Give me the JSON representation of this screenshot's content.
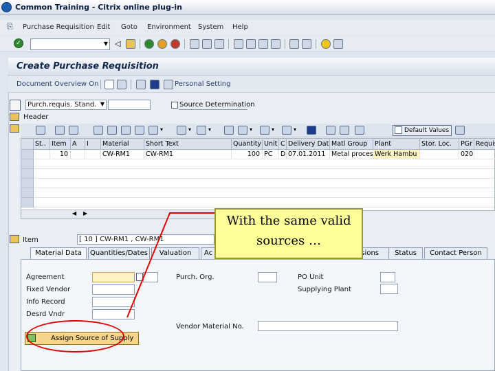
{
  "window": {
    "title": "Common Training - Citrix online plug-in"
  },
  "menu": {
    "items": [
      {
        "label": "Purchase Requisition",
        "underline": "P"
      },
      {
        "label": "Edit",
        "underline": "E"
      },
      {
        "label": "Goto",
        "underline": "G"
      },
      {
        "label": "Environment",
        "underline": "v"
      },
      {
        "label": "System",
        "underline": "y"
      },
      {
        "label": "Help",
        "underline": "H"
      }
    ]
  },
  "screen": {
    "title": "Create Purchase Requisition",
    "toolbar_doc_overview": "Document Overview On",
    "toolbar_personal_setting": "Personal Setting"
  },
  "header_area": {
    "doc_type_value": "Purch.requis. Stand.",
    "source_determination_label": "Source Determination",
    "header_label": "Header",
    "default_values_label": "Default Values"
  },
  "table": {
    "columns": [
      "St..",
      "Item",
      "A",
      "I",
      "Material",
      "Short Text",
      "Quantity",
      "Unit",
      "C",
      "Delivery Date",
      "Matl Group",
      "Plant",
      "Stor. Loc.",
      "PGr",
      "Requis"
    ],
    "rows": [
      [
        "",
        "10",
        "",
        "",
        "CW-RM1",
        "CW-RM1",
        "100",
        "PC",
        "D",
        "07.01.2011",
        "Metal process",
        "Werk Hambu",
        "",
        "020",
        ""
      ]
    ]
  },
  "item_area": {
    "item_label": "Item",
    "item_selector_value": "[ 10 ] CW-RM1 , CW-RM1",
    "tabs": [
      "Material Data",
      "Quantities/Dates",
      "Valuation",
      "Ac",
      "sions",
      "Status",
      "Contact Person"
    ],
    "fields": {
      "agreement": "Agreement",
      "fixed_vendor": "Fixed Vendor",
      "info_record": "Info Record",
      "desrd_vndr": "Desrd Vndr",
      "purch_org": "Purch. Org.",
      "po_unit": "PO Unit",
      "supplying_plant": "Supplying Plant",
      "vendor_material_no": "Vendor Material No."
    },
    "assign_button": "Assign Source of Supply"
  },
  "callout": {
    "line1": "With the same valid",
    "line2": "sources …"
  },
  "colors": {
    "callout_fill": "#ffff99",
    "highlight_oval": "#e00000",
    "pointer_line": "#e00000",
    "required_field": "#fff7c8"
  }
}
